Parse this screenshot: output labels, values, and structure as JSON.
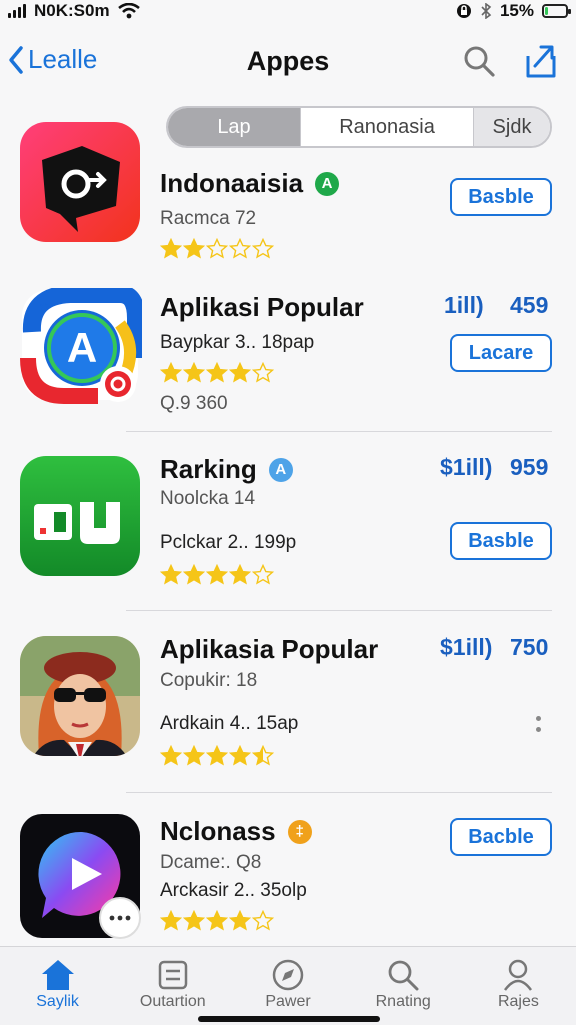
{
  "status_bar": {
    "carrier": "N0K:S0m",
    "battery": "15%",
    "battery_level": 0.15
  },
  "header": {
    "back_label": "Lealle",
    "title": "Appes",
    "search_icon": "search-icon",
    "share_icon": "share-icon"
  },
  "segments": [
    {
      "label": "Lap",
      "selected": true
    },
    {
      "label": "Ranonasia",
      "selected": false
    },
    {
      "label": "Sjdk",
      "selected": false
    }
  ],
  "apps": [
    {
      "name": "Indonaaisia",
      "badge": "A",
      "badge_color": "#1fa84a",
      "line1": "Racmca 72",
      "line2": "",
      "rating": 2,
      "action": "Basble",
      "price": "",
      "count": "",
      "footer": ""
    },
    {
      "name": "Aplikasi Popular",
      "badge": "",
      "badge_color": "",
      "line1": "Baypkar 3.. 18pap",
      "line2": "",
      "rating": 4,
      "action": "Lacare",
      "price": "1ill)",
      "count": "459",
      "footer": "Q.9 360"
    },
    {
      "name": "Rarking",
      "badge": "A",
      "badge_color": "#4ea3e8",
      "line1": "Noolcka 14",
      "line2": "Pclckar 2.. 199p",
      "rating": 4,
      "action": "Basble",
      "price": "$1ill)",
      "count": "959",
      "footer": ""
    },
    {
      "name": "Aplikasia Popular",
      "badge": "",
      "badge_color": "",
      "line1": "Copukir: 18",
      "line2": "Ardkain 4.. 15ap",
      "rating": 4.5,
      "action": "",
      "price": "$1ill)",
      "count": "750",
      "footer": ""
    },
    {
      "name": "Nclonass",
      "badge": "‡",
      "badge_color": "#f0a11b",
      "line1": "Dcame:. Q8",
      "line2": "Arckasir 2.. 35olp",
      "rating": 4,
      "action": "Bacble",
      "price": "",
      "count": "",
      "footer": ""
    }
  ],
  "tabs": [
    {
      "label": "Saylik",
      "icon": "home-icon",
      "active": true
    },
    {
      "label": "Outartion",
      "icon": "list-icon",
      "active": false
    },
    {
      "label": "Pawer",
      "icon": "compass-icon",
      "active": false
    },
    {
      "label": "Rnating",
      "icon": "search-icon",
      "active": false
    },
    {
      "label": "Rajes",
      "icon": "person-icon",
      "active": false
    }
  ],
  "colors": {
    "accent": "#1a73d9",
    "star": "#f5c518",
    "price": "#1a5fbf"
  }
}
